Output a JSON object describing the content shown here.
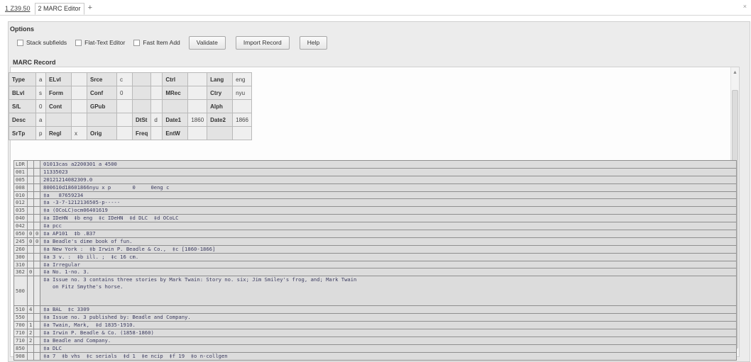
{
  "tabs": [
    {
      "label": "1 Z39.50"
    },
    {
      "label": "2 MARC Editor"
    }
  ],
  "tab_add": "+",
  "window_close": "×",
  "options": {
    "title": "Options",
    "checkboxes": [
      "Stack subfields",
      "Flat-Text Editor",
      "Fast Item Add"
    ],
    "buttons": [
      "Validate",
      "Import Record",
      "Help"
    ]
  },
  "marc_record_title": "MARC Record",
  "fixed_fields": [
    [
      "Type",
      "a",
      "ELvl",
      "",
      "Srce",
      "c",
      "",
      "",
      "Ctrl",
      "",
      "Lang",
      "eng"
    ],
    [
      "BLvl",
      "s",
      "Form",
      "",
      "Conf",
      "0",
      "",
      "",
      "MRec",
      "",
      "Ctry",
      "nyu"
    ],
    [
      "S/L",
      "0",
      "Cont",
      "",
      "GPub",
      "",
      "",
      "",
      "",
      "",
      "Alph",
      ""
    ],
    [
      "Desc",
      "a",
      "",
      "",
      "",
      "",
      "DtSt",
      "d",
      "Date1",
      "1860",
      "Date2",
      "1866"
    ],
    [
      "SrTp",
      "p",
      "Regl",
      "x",
      "Orig",
      "",
      "Freq",
      "",
      "EntW",
      "",
      "",
      ""
    ]
  ],
  "variable_fields": [
    {
      "tag": "LDR",
      "i1": "",
      "i2": "",
      "content": "01013cas a2200301 a 4500"
    },
    {
      "tag": "001",
      "i1": "",
      "i2": "",
      "content": "11335023"
    },
    {
      "tag": "005",
      "i1": "",
      "i2": "",
      "content": "20121214082309.0"
    },
    {
      "tag": "008",
      "i1": "",
      "i2": "",
      "content": "800610d18601866nyu x p       0     0eng c"
    },
    {
      "tag": "010",
      "i1": "",
      "i2": "",
      "content": "‡a   87659234"
    },
    {
      "tag": "012",
      "i1": "",
      "i2": "",
      "content": "‡a -3-7-1212136505-p-----"
    },
    {
      "tag": "035",
      "i1": "",
      "i2": "",
      "content": "‡a (OCoLC)ocm06401619"
    },
    {
      "tag": "040",
      "i1": "",
      "i2": "",
      "content": "‡a IDeHN  ‡b eng  ‡c IDeHN  ‡d DLC  ‡d OCoLC"
    },
    {
      "tag": "042",
      "i1": "",
      "i2": "",
      "content": "‡a pcc"
    },
    {
      "tag": "050",
      "i1": "0",
      "i2": "0",
      "content": "‡a AP101  ‡b .B37"
    },
    {
      "tag": "245",
      "i1": "0",
      "i2": "0",
      "content": "‡a Beadle's dime book of fun."
    },
    {
      "tag": "260",
      "i1": "",
      "i2": "",
      "content": "‡a New York :  ‡b Irwin P. Beadle & Co.,  ‡c [1860-1866]"
    },
    {
      "tag": "300",
      "i1": "",
      "i2": "",
      "content": "‡a 3 v. :  ‡b ill. ;  ‡c 16 cm."
    },
    {
      "tag": "310",
      "i1": "",
      "i2": "",
      "content": "‡a Irregular"
    },
    {
      "tag": "362",
      "i1": "0",
      "i2": "",
      "content": "‡a No. 1-no. 3."
    },
    {
      "tag": "500",
      "i1": "",
      "i2": "",
      "content": "‡a Issue no. 3 contains three stories by Mark Twain: Story no. six; Jim Smiley's frog, and; Mark Twain\n   on Fitz Smythe's horse."
    },
    {
      "tag": "510",
      "i1": "4",
      "i2": "",
      "content": "‡a BAL  ‡c 3309"
    },
    {
      "tag": "550",
      "i1": "",
      "i2": "",
      "content": "‡a Issue no. 3 published by: Beadle and Company."
    },
    {
      "tag": "700",
      "i1": "1",
      "i2": "",
      "content": "‡a Twain, Mark,  ‡d 1835-1910."
    },
    {
      "tag": "710",
      "i1": "2",
      "i2": "",
      "content": "‡a Irwin P. Beadle & Co. (1858-1860)"
    },
    {
      "tag": "710",
      "i1": "2",
      "i2": "",
      "content": "‡a Beadle and Company."
    },
    {
      "tag": "850",
      "i1": "",
      "i2": "",
      "content": "‡a DLC"
    },
    {
      "tag": "908",
      "i1": "",
      "i2": "",
      "content": "‡a 7  ‡b vhs  ‡c serials  ‡d 1  ‡e ncip  ‡f 19  ‡o n-collgen"
    }
  ],
  "colors": {
    "panel": "#ececec",
    "row": "#dcdcdc",
    "text": "#3c3c60"
  }
}
